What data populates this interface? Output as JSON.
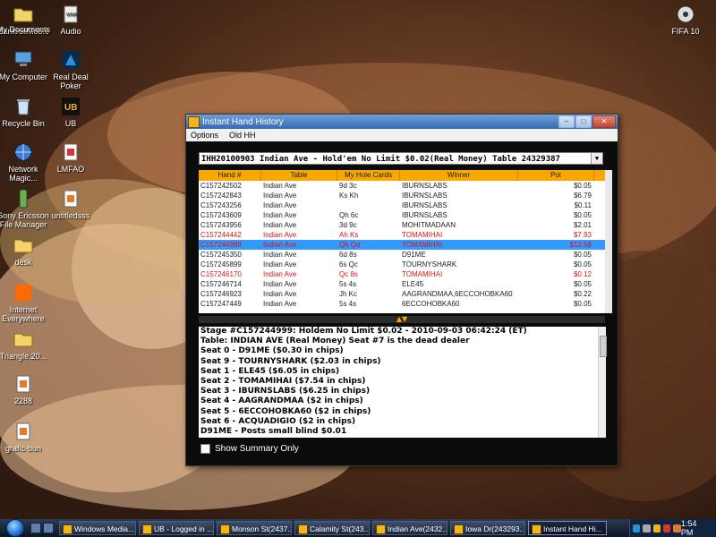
{
  "desktop": {
    "icons": [
      {
        "label": "BankrollMob.c"
      },
      {
        "label": "Audio"
      },
      {
        "label": "My Documents"
      },
      {
        "label": "My Computer"
      },
      {
        "label": "Real Deal Poker"
      },
      {
        "label": "Recycle Bin"
      },
      {
        "label": "UB"
      },
      {
        "label": "Network Magic..."
      },
      {
        "label": "LMFAO"
      },
      {
        "label": "Sony Ericsson File Manager"
      },
      {
        "label": "untitledsss"
      },
      {
        "label": "desk"
      },
      {
        "label": "Internet Everywhere"
      },
      {
        "label": "Triangle.20..."
      },
      {
        "label": "2288"
      },
      {
        "label": "grafic-bun"
      },
      {
        "label": "FIFA 10"
      }
    ]
  },
  "window": {
    "title": "Instant Hand History",
    "menu": [
      "Options",
      "Old HH"
    ],
    "hand_select": "IHH20100903 Indian Ave - Hold'em No Limit $0.02(Real Money) Table 24329387",
    "columns": [
      "Hand #",
      "Table",
      "My Hole Cards",
      "Winner",
      "Pot"
    ],
    "rows": [
      {
        "hand": "C157242502",
        "table": "Indian Ave",
        "cards": "9d 3c",
        "winner": "IBURNSLABS",
        "pot": "$0.05",
        "style": "normal"
      },
      {
        "hand": "C157242843",
        "table": "Indian Ave",
        "cards": "Ks Kh",
        "winner": "IBURNSLABS",
        "pot": "$6.79",
        "style": "normal"
      },
      {
        "hand": "C157243256",
        "table": "Indian Ave",
        "cards": "",
        "winner": "IBURNSLABS",
        "pot": "$0.11",
        "style": "normal"
      },
      {
        "hand": "C157243609",
        "table": "Indian Ave",
        "cards": "Qh 6c",
        "winner": "IBURNSLABS",
        "pot": "$0.05",
        "style": "normal"
      },
      {
        "hand": "C157243956",
        "table": "Indian Ave",
        "cards": "3d 9c",
        "winner": "MOHITMADAAN",
        "pot": "$2.01",
        "style": "normal"
      },
      {
        "hand": "C157244442",
        "table": "Indian Ave",
        "cards": "Ah Ks",
        "winner": "TOMAMIHAI",
        "pot": "$7.93",
        "style": "red"
      },
      {
        "hand": "C157244999",
        "table": "Indian Ave",
        "cards": "Qh Qd",
        "winner": "TOMAMIHAI",
        "pot": "$12.58",
        "style": "sel"
      },
      {
        "hand": "C157245350",
        "table": "Indian Ave",
        "cards": "6d 8s",
        "winner": "D91ME",
        "pot": "$0.05",
        "style": "normal"
      },
      {
        "hand": "C157245899",
        "table": "Indian Ave",
        "cards": "6s Qc",
        "winner": "TOURNYSHARK",
        "pot": "$0.05",
        "style": "normal"
      },
      {
        "hand": "C157246170",
        "table": "Indian Ave",
        "cards": "Qc 8s",
        "winner": "TOMAMIHAI",
        "pot": "$0.12",
        "style": "red"
      },
      {
        "hand": "C157246714",
        "table": "Indian Ave",
        "cards": "5s 4s",
        "winner": "ELE45",
        "pot": "$0.05",
        "style": "normal"
      },
      {
        "hand": "C157246923",
        "table": "Indian Ave",
        "cards": "Jh Kc",
        "winner": "AAGRANDMAA,6ECCOHOBKA60",
        "pot": "$0.22",
        "style": "normal"
      },
      {
        "hand": "C157247449",
        "table": "Indian Ave",
        "cards": "5s 4s",
        "winner": "6ECCOHOBKA60",
        "pot": "$0.05",
        "style": "normal"
      }
    ],
    "detail_lines": [
      "Stage #C157244999: Holdem  No Limit $0.02 - 2010-09-03 06:42:24 (ET)",
      "Table: INDIAN AVE (Real Money) Seat #7 is the dead dealer",
      "Seat 0 - D91ME ($0.30 in chips)",
      "Seat 9 - TOURNYSHARK ($2.03 in chips)",
      "Seat 1 - ELE45 ($6.05 in chips)",
      "Seat 2 - TOMAMIHAI ($7.54 in chips)",
      "Seat 3 - IBURNSLABS ($6.25 in chips)",
      "Seat 4 - AAGRANDMAA ($2 in chips)",
      "Seat 5 - 6ECCOHOBKA60 ($2 in chips)",
      "Seat 6 - ACQUADIGIO ($2 in chips)",
      "D91ME - Posts small blind $0.01"
    ],
    "summary_label": "Show Summary Only"
  },
  "taskbar": {
    "tasks": [
      {
        "label": "Windows Media..."
      },
      {
        "label": "UB - Logged in ..."
      },
      {
        "label": "Monson St(2437..."
      },
      {
        "label": "Calamity St(243..."
      },
      {
        "label": "Indian Ave(2432..."
      },
      {
        "label": "Iowa Dr(243293..."
      },
      {
        "label": "Instant Hand Hi..."
      }
    ],
    "clock": "1:54 PM"
  }
}
